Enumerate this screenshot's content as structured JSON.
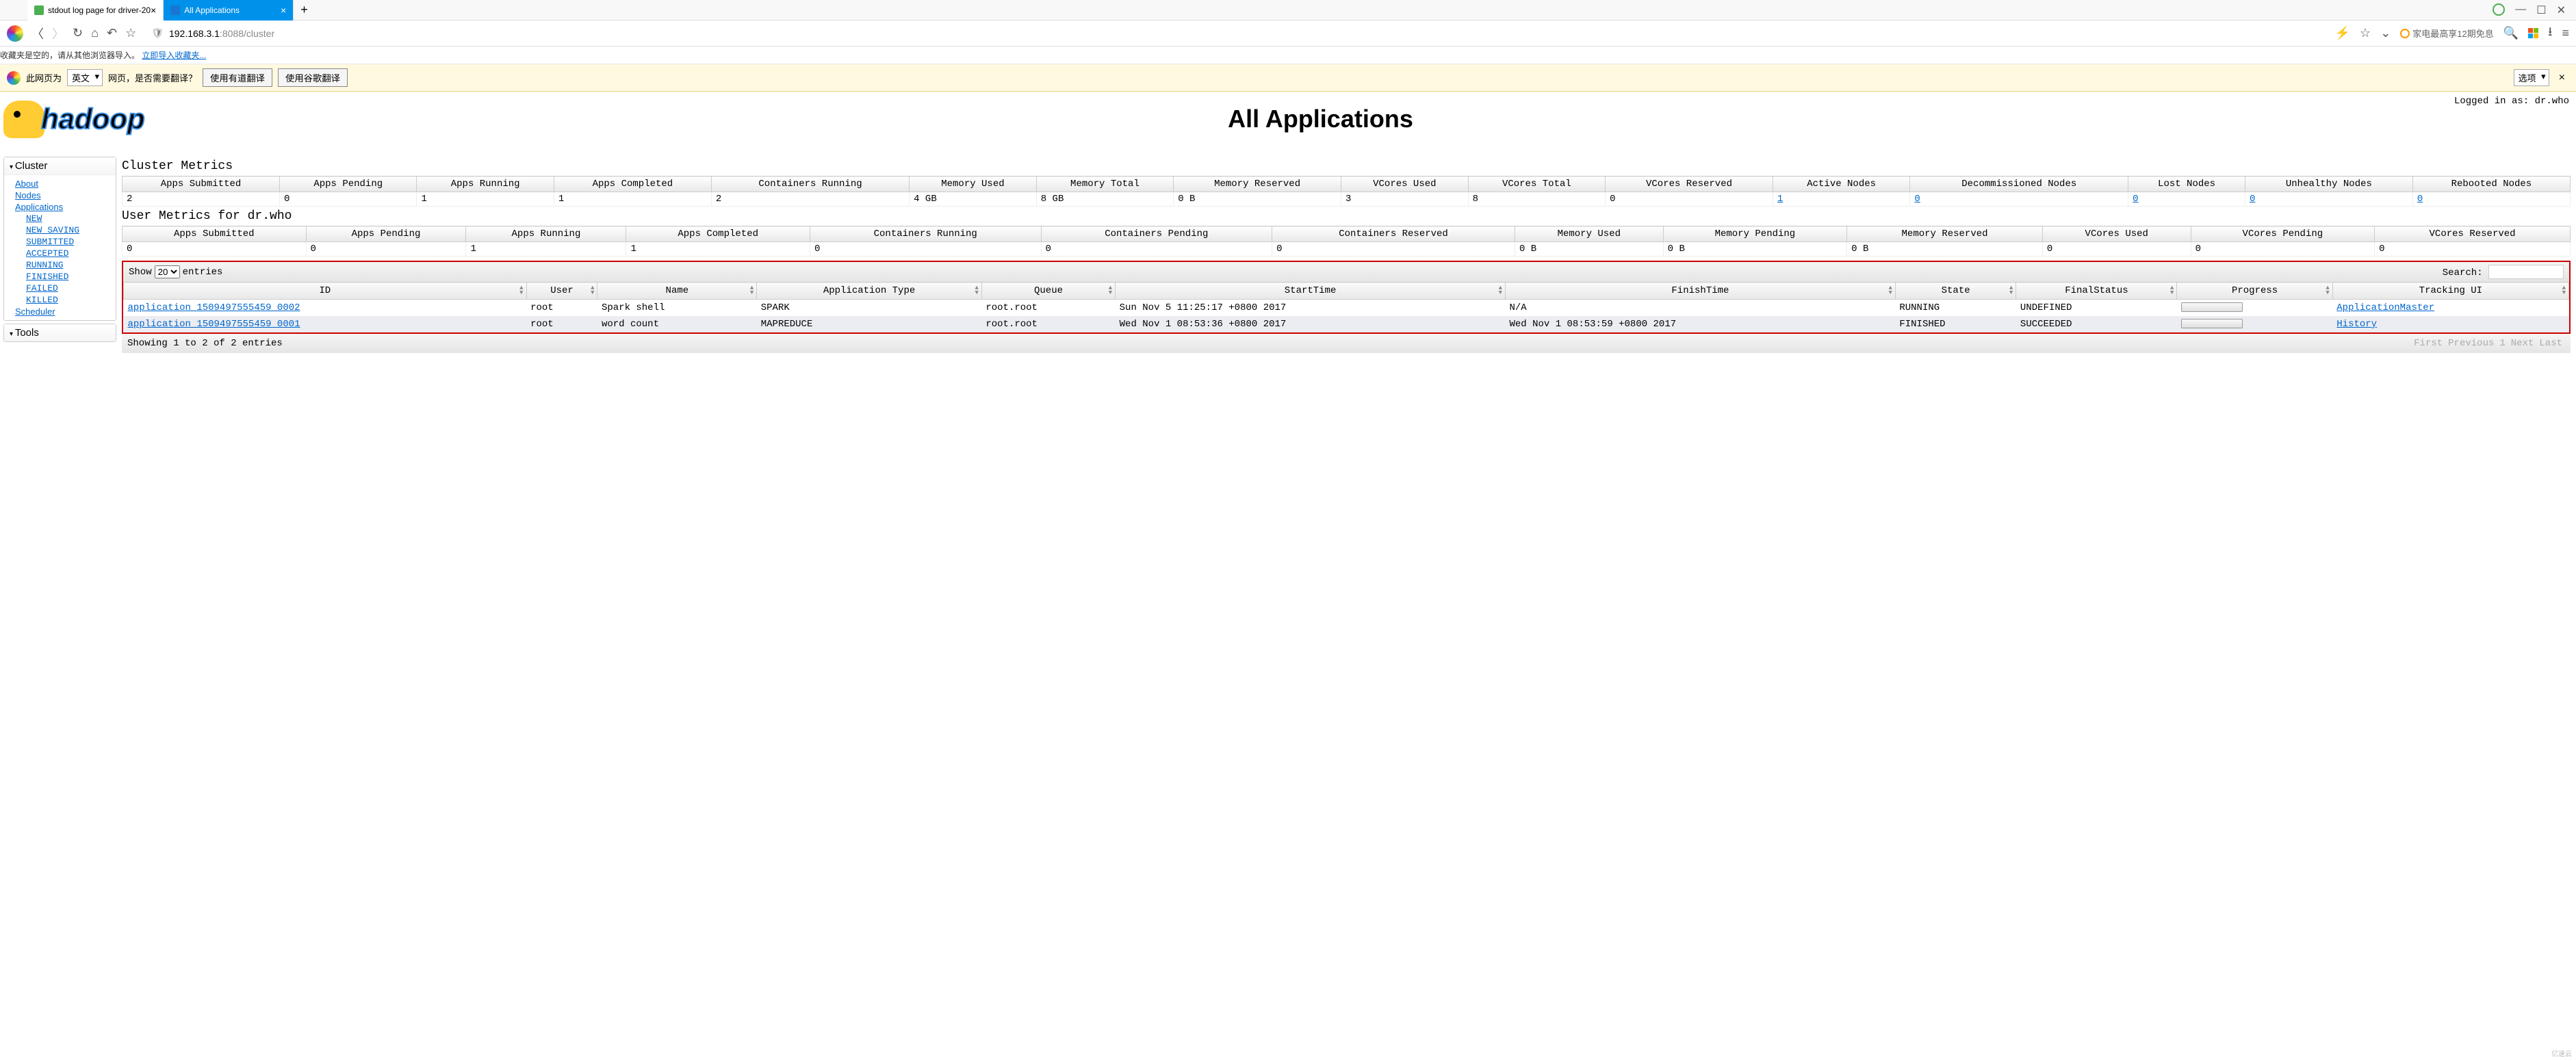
{
  "browser": {
    "tab1": "stdout log page for driver-20",
    "tab2": "All Applications",
    "url_host": "192.168.3.1",
    "url_port_path": ":8088/cluster",
    "promo": "家电最高享12期免息",
    "fav_empty": "收藏夹是空的，请从其他浏览器导入。",
    "fav_link": "立即导入收藏夹...",
    "tr_prefix": "此网页为",
    "tr_lang": "英文",
    "tr_suffix": "网页，是否需要翻译？",
    "tr_btn1": "使用有道翻译",
    "tr_btn2": "使用谷歌翻译",
    "tr_opts": "选项"
  },
  "page": {
    "login": "Logged in as: dr.who",
    "title": "All Applications"
  },
  "sidebar": {
    "cluster": "Cluster",
    "about": "About",
    "nodes": "Nodes",
    "apps": "Applications",
    "states": [
      "NEW",
      "NEW_SAVING",
      "SUBMITTED",
      "ACCEPTED",
      "RUNNING",
      "FINISHED",
      "FAILED",
      "KILLED"
    ],
    "scheduler": "Scheduler",
    "tools": "Tools"
  },
  "cm": {
    "title": "Cluster Metrics",
    "h": [
      "Apps Submitted",
      "Apps Pending",
      "Apps Running",
      "Apps Completed",
      "Containers Running",
      "Memory Used",
      "Memory Total",
      "Memory Reserved",
      "VCores Used",
      "VCores Total",
      "VCores Reserved",
      "Active Nodes",
      "Decommissioned Nodes",
      "Lost Nodes",
      "Unhealthy Nodes",
      "Rebooted Nodes"
    ],
    "v": [
      "2",
      "0",
      "1",
      "1",
      "2",
      "4 GB",
      "8 GB",
      "0 B",
      "3",
      "8",
      "0",
      "1",
      "0",
      "0",
      "0",
      "0"
    ]
  },
  "um": {
    "title": "User Metrics for dr.who",
    "h": [
      "Apps Submitted",
      "Apps Pending",
      "Apps Running",
      "Apps Completed",
      "Containers Running",
      "Containers Pending",
      "Containers Reserved",
      "Memory Used",
      "Memory Pending",
      "Memory Reserved",
      "VCores Used",
      "VCores Pending",
      "VCores Reserved"
    ],
    "v": [
      "0",
      "0",
      "1",
      "1",
      "0",
      "0",
      "0",
      "0 B",
      "0 B",
      "0 B",
      "0",
      "0",
      "0"
    ]
  },
  "dt": {
    "show": "Show",
    "entries": "entries",
    "page_size": "20",
    "search": "Search:",
    "h": [
      "ID",
      "User",
      "Name",
      "Application Type",
      "Queue",
      "StartTime",
      "FinishTime",
      "State",
      "FinalStatus",
      "Progress",
      "Tracking UI"
    ],
    "rows": [
      {
        "id": "application_1509497555459_0002",
        "user": "root",
        "name": "Spark shell",
        "type": "SPARK",
        "queue": "root.root",
        "start": "Sun Nov 5 11:25:17 +0800 2017",
        "finish": "N/A",
        "state": "RUNNING",
        "final": "UNDEFINED",
        "track": "ApplicationMaster"
      },
      {
        "id": "application_1509497555459_0001",
        "user": "root",
        "name": "word count",
        "type": "MAPREDUCE",
        "queue": "root.root",
        "start": "Wed Nov 1 08:53:36 +0800 2017",
        "finish": "Wed Nov 1 08:53:59 +0800 2017",
        "state": "FINISHED",
        "final": "SUCCEEDED",
        "track": "History"
      }
    ],
    "info": "Showing 1 to 2 of 2 entries",
    "pag": [
      "First",
      "Previous",
      "1",
      "Next",
      "Last"
    ]
  }
}
